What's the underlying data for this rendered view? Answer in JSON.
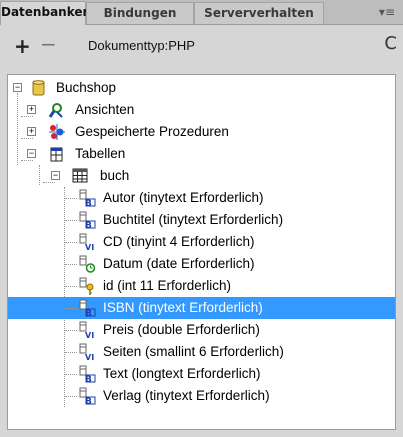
{
  "tabs": [
    {
      "label": "Datenbanken",
      "active": true
    },
    {
      "label": "Bindungen",
      "active": false
    },
    {
      "label": "Serververhalten",
      "active": false
    }
  ],
  "toolbar": {
    "plus": "+",
    "minus": "−",
    "doctype": "Dokumenttyp:PHP",
    "refresh": "C"
  },
  "tree": {
    "root": "Buchshop",
    "ansichten": "Ansichten",
    "prozeduren": "Gespeicherte Prozeduren",
    "tabellen": "Tabellen",
    "table": "buch",
    "columns": [
      {
        "label": "Autor (tinytext Erforderlich)",
        "icon": "text-column-icon"
      },
      {
        "label": "Buchtitel (tinytext Erforderlich)",
        "icon": "text-column-icon"
      },
      {
        "label": "CD (tinyint 4 Erforderlich)",
        "icon": "integer-column-icon"
      },
      {
        "label": "Datum (date Erforderlich)",
        "icon": "date-column-icon"
      },
      {
        "label": "id (int 11 Erforderlich)",
        "icon": "key-column-icon"
      },
      {
        "label": "ISBN (tinytext Erforderlich)",
        "icon": "text-column-icon",
        "selected": true
      },
      {
        "label": "Preis (double Erforderlich)",
        "icon": "integer-column-icon"
      },
      {
        "label": "Seiten (smallint 6 Erforderlich)",
        "icon": "integer-column-icon"
      },
      {
        "label": "Text (longtext Erforderlich)",
        "icon": "text-column-icon"
      },
      {
        "label": "Verlag (tinytext Erforderlich)",
        "icon": "text-column-icon"
      }
    ]
  },
  "colors": {
    "selection": "#3399ff",
    "panel": "#d6d6d6",
    "tree_bg": "#ffffff"
  }
}
